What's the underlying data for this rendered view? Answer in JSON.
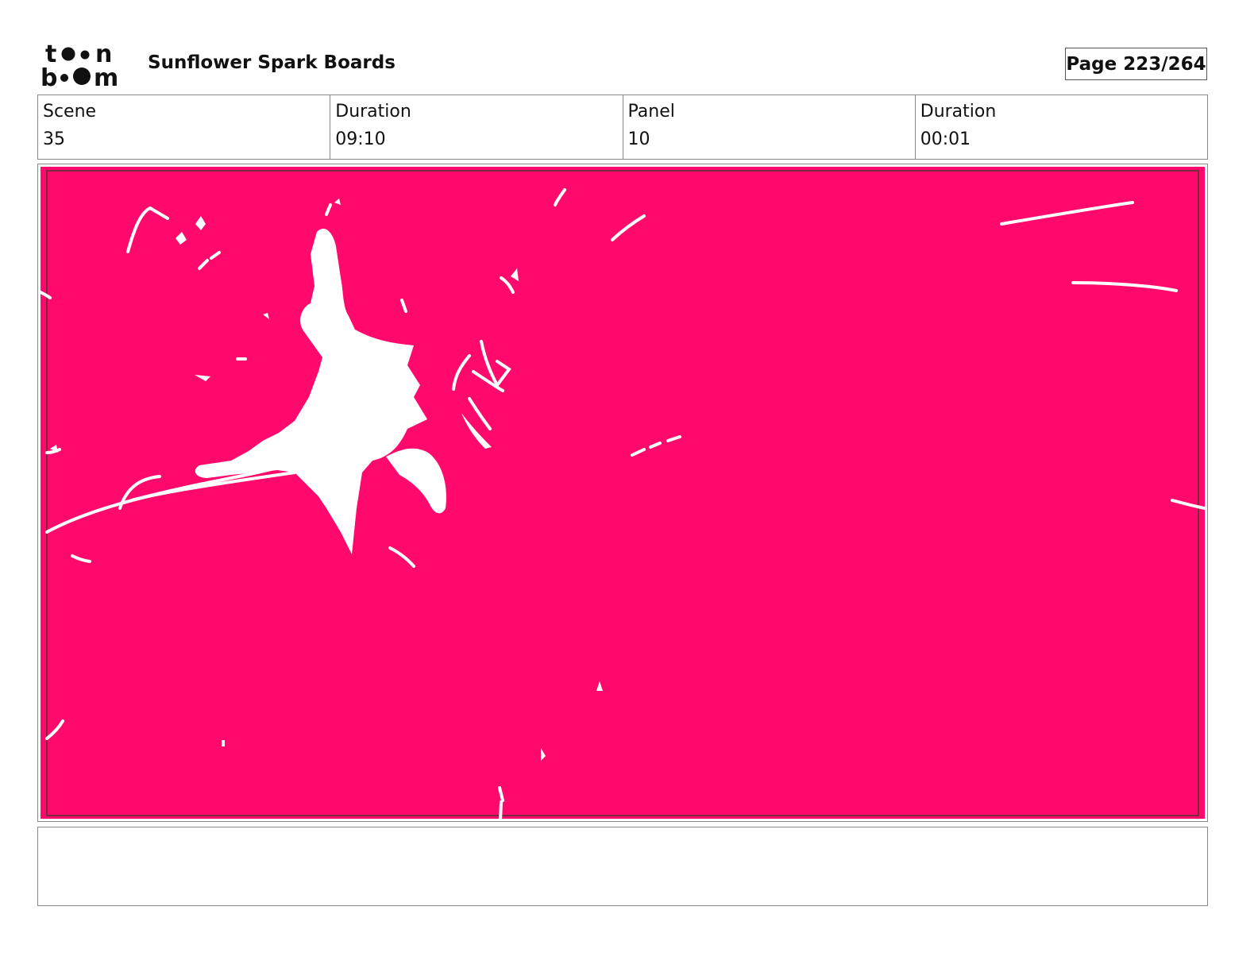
{
  "header": {
    "logo_name": "toon-boom-logo",
    "project_title": "Sunflower Spark Boards",
    "page_label": "Page 223/264"
  },
  "info": [
    {
      "label": "Scene",
      "value": "35"
    },
    {
      "label": "Duration",
      "value": "09:10"
    },
    {
      "label": "Panel",
      "value": "10"
    },
    {
      "label": "Duration",
      "value": "00:01"
    }
  ],
  "panel": {
    "background_color": "#FF0A6C",
    "splash_color": "#FFFFFF",
    "safe_frame_color": "#7A2A40"
  },
  "notes": {
    "text": ""
  }
}
